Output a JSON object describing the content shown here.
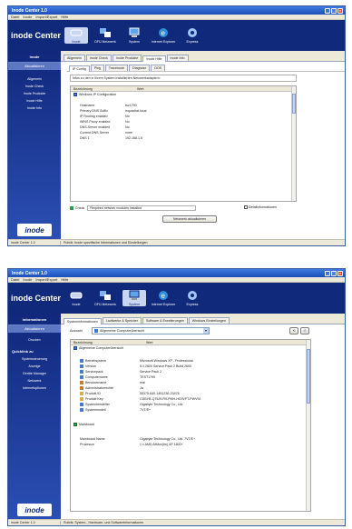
{
  "window1": {
    "title": "Inode Center 1.0",
    "menu": [
      "Datei",
      "Inode",
      "Import/Export",
      "Hilfe"
    ],
    "brand": "inode Center",
    "toolbar": [
      "Inode",
      "DFÜ-Netzwerk",
      "System",
      "Internet Explorer",
      "Express"
    ],
    "sidebar": {
      "head": "Inode",
      "sub": "Aktualisieren",
      "items": [
        "Allgemein",
        "Inode Check",
        "Inode Produkte",
        "Inode Hilfe",
        "Inode Info"
      ]
    },
    "tabs": [
      "Allgemein",
      "Inode Check",
      "Inode Produkte",
      "Inode Hilfe",
      "Inode Info"
    ],
    "subtabs": [
      "IP Config",
      "Ping",
      "Traceroute",
      "Diagnose",
      "DOS"
    ],
    "info_text": "Infos zu den in Ihrem System installierten Netzwerkadaptern:",
    "columns": [
      "Bezeichnung",
      "Wert"
    ],
    "group": "Windows IP Configuration",
    "rows": [
      {
        "k": "Hostname",
        "v": "tsv1790"
      },
      {
        "k": "Primary DNS Suffix",
        "v": "inquadrat.local"
      },
      {
        "k": "IP Routing enabled",
        "v": "No"
      },
      {
        "k": "WINS Proxy enabled",
        "v": "No"
      },
      {
        "k": "DNS-Server enabled",
        "v": "No"
      },
      {
        "k": "Current DNS Server",
        "v": "none"
      },
      {
        "k": "DNS 1",
        "v": "192.168.1.5"
      }
    ],
    "check_label": "Check",
    "check_text": "Required network modules installed",
    "detail_label": "Detailinformationen",
    "refresh_button": "Netzwerk aktualisieren",
    "status_left": "inode Center 1.0",
    "status_right": "Pubrik: Inode spezifische Informationen und Einstellungen"
  },
  "window2": {
    "title": "Inode Center 1.0",
    "menu": [
      "Datei",
      "Inode",
      "Import/Export",
      "Hilfe"
    ],
    "brand": "inode Center",
    "toolbar": [
      "Inode",
      "DFÜ-Netzwerk",
      "System",
      "Internet Explorer",
      "Express"
    ],
    "sidebar": {
      "head": "Informationen",
      "sub": "Aktualisieren",
      "item": "Drucken",
      "section": "Quicklink zu",
      "links": [
        "Systemsteuerung",
        "Anzeige",
        "Geräte Manager",
        "Netzwerk",
        "Internetoptionen"
      ]
    },
    "tabs": [
      "Systeminformationen",
      "Laufwerke & Speicher",
      "Software & Erweiterungen",
      "Windows Einstellungen"
    ],
    "select_label": "Auswahl",
    "select_value": "Allgemeine Computerübersicht",
    "columns": [
      "Bezeichnung",
      "Wert"
    ],
    "group1": "Allgemeine Computerübersicht",
    "rows": [
      {
        "k": "Betriebsystem",
        "v": "Microsoft Windows XP - Professional"
      },
      {
        "k": "Version",
        "v": "5.1.2600 Service Pack 2 Build 2600"
      },
      {
        "k": "Servicepack",
        "v": "Service Pack 2"
      },
      {
        "k": "Computername",
        "v": "TEST1790"
      },
      {
        "k": "Benutzername",
        "v": "mai"
      },
      {
        "k": "Administratorrechte",
        "v": "Ja"
      },
      {
        "k": "Produkt ID",
        "v": "55375-640-1451236-23476"
      },
      {
        "k": "Produkt Key",
        "v": "CDBYB-Q75J9-R9-PMH-HC9VFT-PWV9J"
      },
      {
        "k": "Systemhersteller",
        "v": "Gigabyte Technology Co., Ltd."
      },
      {
        "k": "Systemmodell",
        "v": "7VT/E+"
      }
    ],
    "group2": "Mainboard",
    "rows2": [
      {
        "k": "Mainboard Name",
        "v": "Gigabyte Technology Co., Ltd. 7VT/E+"
      },
      {
        "k": "Prozessor",
        "v": "1 x AMD Athlon(tm) XP 1800+"
      }
    ],
    "status_left": "inode Center 1.0",
    "status_right": "Rubrik: System-, Hardware- und Softwareinformationen"
  }
}
